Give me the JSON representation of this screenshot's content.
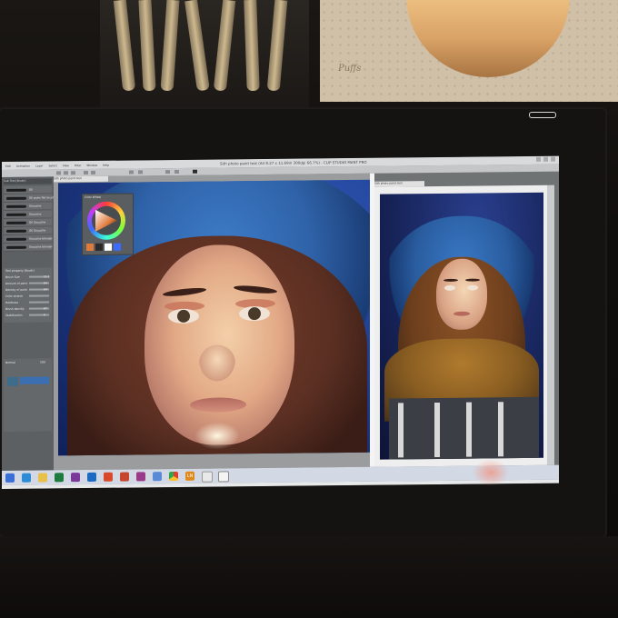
{
  "app": {
    "window_title": "Sith photo paint test (A4 8.27 x 11.69in 300dpi 66.7%) - CLIP STUDIO PAINT PRO",
    "menu": [
      "Edit",
      "Animation",
      "Layer",
      "Select",
      "View",
      "Filter",
      "Window",
      "Help"
    ]
  },
  "left_panel": {
    "subtool_header": "Sub Tool [Brush]",
    "brushes": [
      "Oil",
      "Oil paint flat brush",
      "Gouache",
      "Gouache",
      "Oil Gouache",
      "Oil Gouache",
      "Gouache blender",
      "Gouache blender"
    ],
    "tool_property_title": "Tool property [Brush]",
    "properties": [
      "Brush Size",
      "Amount of paint",
      "Density of paint",
      "Color stretch",
      "Hardness",
      "Brush density",
      "Stabilization"
    ],
    "property_values": [
      "15.0",
      "64",
      "64",
      "",
      "",
      "87",
      "6"
    ],
    "layer_blend_mode": "Normal",
    "layer_opacity": "100"
  },
  "color_wheel": {
    "title": "Color Wheel",
    "swatch_colors": [
      "#e07a3a",
      "#2a2a2a",
      "#ffffff",
      "#3b6cff"
    ]
  },
  "canvas1": {
    "tab": "Sith photo paint test"
  },
  "canvas2": {
    "tab": "Sith photo paint test"
  },
  "taskbar": {
    "icons": [
      "windows-icon",
      "ie-icon",
      "folder-icon",
      "excel-icon",
      "onenote-icon",
      "outlook-icon",
      "office-icon",
      "powerpoint-icon",
      "chrome-icon",
      "ln-icon",
      "clip-studio-icon",
      "other-icon"
    ],
    "ln_label": "LN"
  },
  "scene": {
    "tissue_logo": "Puffs"
  }
}
